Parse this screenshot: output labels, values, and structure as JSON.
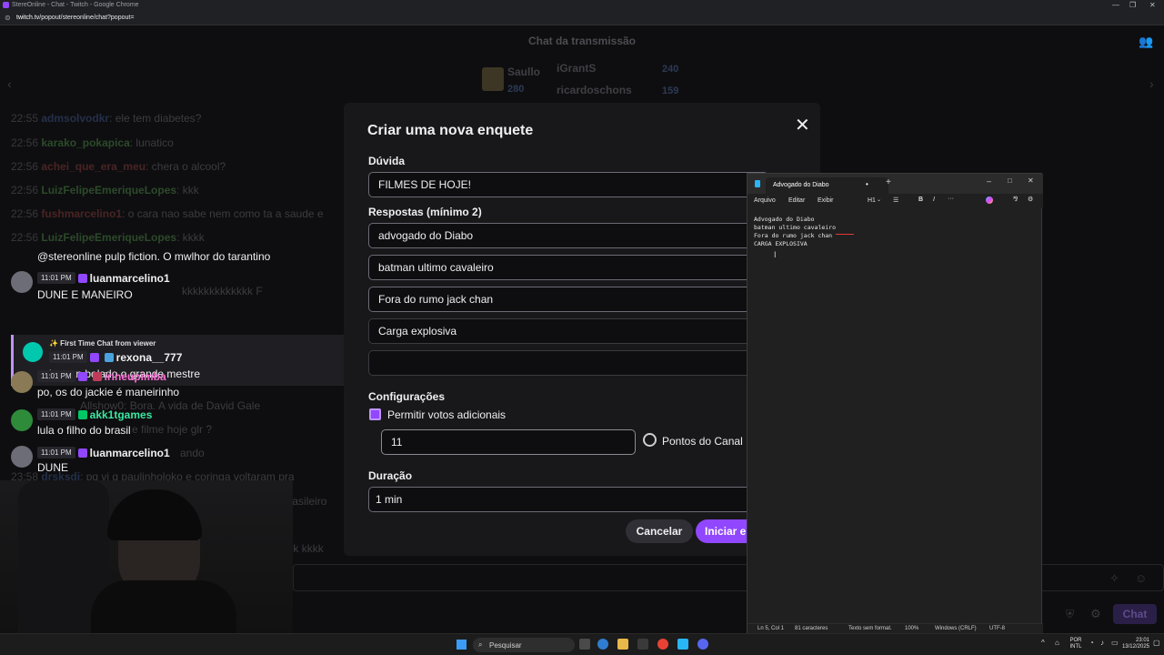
{
  "browser": {
    "window_title": "StereOnline - Chat - Twitch - Google Chrome",
    "url_host": "twitch.tv",
    "url_path": "/popout/stereonline/chat?popout=",
    "min": "—",
    "max": "❐",
    "close": "✕"
  },
  "chat": {
    "header": "Chat da transmissão",
    "leaderboard": {
      "gifter": "Saullo",
      "gifter_count": "280",
      "top1_name": "iGrantS",
      "top1_count": "240",
      "top2_name": "ricardoschons",
      "top2_count": "159"
    },
    "dim_messages": [
      {
        "ts": "22:55",
        "name": "admsolvodkr",
        "text": ": ele tem diabetes?"
      },
      {
        "ts": "22:56",
        "name": "karako_pokapica",
        "text": ": lunatico"
      },
      {
        "ts": "22:56",
        "name": "achei_que_era_meu",
        "text": ": chera o alcool?"
      },
      {
        "ts": "22:56",
        "name": "LuizFelipeEmeriqueLopes",
        "text": ": kkk"
      },
      {
        "ts": "22:56",
        "name": "fushmarcelino1",
        "text": ": o cara nao sabe nem como ta a saude e"
      },
      {
        "ts": "22:56",
        "name": "LuizFelipeEmeriqueLopes",
        "text": ": kkkk"
      }
    ],
    "live_messages": {
      "pulp": "@stereonline pulp fiction. O mwlhor do tarantino",
      "m1_time": "11:01 PM",
      "m1_user": "luanmarcelino1",
      "m1_text": "DUNE E MANEIRO",
      "first_time_label": "✨ First Time Chat from viewer",
      "m2_time": "11:01 PM",
      "m2_user": "rexona__777",
      "m2_text": "ip man bolado o grande mestre",
      "m3_time": "11:01 PM",
      "m3_user": "irineupimba",
      "m3_text": "po, os do jackie é maneirinho",
      "m4_time": "11:01 PM",
      "m4_user": "akk1tgames",
      "m4_text": "lula o filho do brasil",
      "m5_time": "11:01 PM",
      "m5_user": "luanmarcelino1",
      "m5_text": "DUNE"
    },
    "ghost_lines": [
      "kkkkkkkkkkkkk F",
      "Allshow0: Bora. A vida de David Gale",
      "e filme hoje glr ?",
      "ando",
      "pq vi q paulinholoko e coringa voltaram pra",
      "tem esse jeitinho Brasileiro",
      "o que faz hein sik kkkk"
    ],
    "ghost_ts": "23:58",
    "ghost_name": "drsksdi",
    "chat_button": "Chat"
  },
  "poll": {
    "title": "Criar uma nova enquete",
    "question_label": "Dúvida",
    "question_value": "FILMES DE HOJE!",
    "answers_label": "Respostas (mínimo 2)",
    "answers": [
      "advogado do Diabo",
      "batman ultimo cavaleiro",
      "Fora do rumo jack chan",
      "Carga explosiva",
      ""
    ],
    "settings_label": "Configurações",
    "extra_votes_label": "Permitir votos adicionais",
    "extra_votes_value": "11",
    "channel_points_label": "Pontos do Canal",
    "duration_label": "Duração",
    "duration_value": "1 min",
    "cancel": "Cancelar",
    "start": "Iniciar e"
  },
  "notepad": {
    "tab_title": "Advogado do Diabo",
    "menu": [
      "Arquivo",
      "Editar",
      "Exibir"
    ],
    "heading_select": "H1",
    "lines": [
      "Advogado do Diabo",
      "batman ultimo cavaleiro",
      "Fora do rumo jack chan",
      "CARGA EXPLOSIVA"
    ],
    "status": {
      "position": "Ln 5, Col 1",
      "chars": "81 caracteres",
      "format": "Texto sem format.",
      "zoom": "100%",
      "eol": "Windows (CRLF)",
      "encoding": "UTF-8"
    }
  },
  "taskbar": {
    "search_placeholder": "Pesquisar",
    "lang1": "POR",
    "lang2": "INTL",
    "time": "23:01",
    "date": "13/12/2025"
  }
}
